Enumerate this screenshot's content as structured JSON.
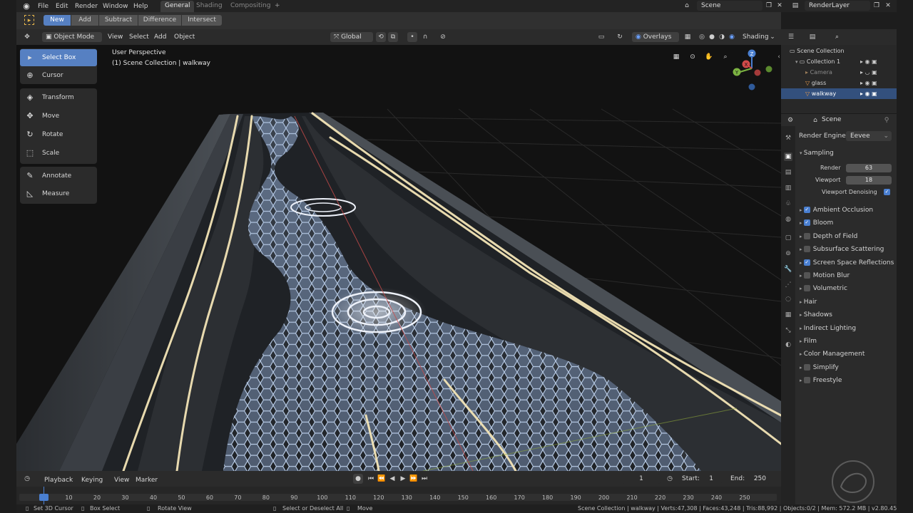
{
  "topbar": {
    "menus": [
      "File",
      "Edit",
      "Render",
      "Window",
      "Help"
    ],
    "workspace_tabs": [
      "General",
      "Shading",
      "Compositing"
    ],
    "active_tab": "General",
    "scene": "Scene",
    "render_layer": "RenderLayer"
  },
  "tool_header": {
    "modes": [
      "New",
      "Add",
      "Subtract",
      "Difference",
      "Intersect"
    ],
    "active_mode": "New"
  },
  "viewport_header": {
    "mode": "Object Mode",
    "menus": [
      "View",
      "Select",
      "Add",
      "Object"
    ],
    "transform_orientation": "Global",
    "overlays": "Overlays",
    "shading": "Shading"
  },
  "toolshelf": {
    "tools": [
      "Select Box",
      "Cursor",
      "Transform",
      "Move",
      "Rotate",
      "Scale",
      "Annotate",
      "Measure"
    ],
    "active": "Select Box"
  },
  "viewport": {
    "perspective_label": "User Perspective",
    "collection_label": "(1) Scene Collection | walkway",
    "gizmo_axes": [
      "X",
      "Y",
      "Z"
    ]
  },
  "outliner": {
    "root": "Scene Collection",
    "collection": "Collection 1",
    "items": [
      "Camera",
      "glass",
      "walkway"
    ],
    "selected": "walkway"
  },
  "properties": {
    "header": "Scene",
    "render_engine_label": "Render Engine",
    "render_engine": "Eevee",
    "sampling_label": "Sampling",
    "render_label": "Render",
    "render_samples": "63",
    "viewport_label": "Viewport",
    "viewport_samples": "18",
    "viewport_denoising": "Viewport Denoising",
    "panels": [
      {
        "label": "Ambient Occlusion",
        "checkbox": true,
        "checked": true
      },
      {
        "label": "Bloom",
        "checkbox": true,
        "checked": true
      },
      {
        "label": "Depth of Field",
        "checkbox": true,
        "checked": false
      },
      {
        "label": "Subsurface Scattering",
        "checkbox": true,
        "checked": false
      },
      {
        "label": "Screen Space Reflections",
        "checkbox": true,
        "checked": true
      },
      {
        "label": "Motion Blur",
        "checkbox": true,
        "checked": false
      },
      {
        "label": "Volumetric",
        "checkbox": true,
        "checked": false
      },
      {
        "label": "Hair",
        "checkbox": false,
        "checked": false
      },
      {
        "label": "Shadows",
        "checkbox": false,
        "checked": false
      },
      {
        "label": "Indirect Lighting",
        "checkbox": false,
        "checked": false
      },
      {
        "label": "Film",
        "checkbox": false,
        "checked": false
      },
      {
        "label": "Color Management",
        "checkbox": false,
        "checked": false
      },
      {
        "label": "Simplify",
        "checkbox": true,
        "checked": false
      },
      {
        "label": "Freestyle",
        "checkbox": true,
        "checked": false
      }
    ]
  },
  "timeline": {
    "menus": [
      "Playback",
      "Keying",
      "View",
      "Marker"
    ],
    "current_frame": "1",
    "start_label": "Start:",
    "start": "1",
    "end_label": "End:",
    "end": "250",
    "frame_ticks": [
      "1",
      "10",
      "20",
      "30",
      "40",
      "50",
      "60",
      "70",
      "80",
      "90",
      "100",
      "110",
      "120",
      "130",
      "140",
      "150",
      "160",
      "170",
      "180",
      "190",
      "200",
      "210",
      "220",
      "230",
      "240",
      "250"
    ]
  },
  "statusbar": {
    "left": [
      "Set 3D Cursor",
      "Box Select",
      "Rotate View"
    ],
    "mid": [
      "Select or Deselect All",
      "Move"
    ],
    "stats": "Scene Collection | walkway | Verts:47,308 | Faces:43,248 | Tris:88,992 | Objects:0/2 | Mem: 572.2 MB | v2.80.45"
  },
  "colors": {
    "accent": "#5680c2",
    "selected_row": "#33507d",
    "glow": "#f3e4b6",
    "hex_floor": "#8ea6c8"
  }
}
